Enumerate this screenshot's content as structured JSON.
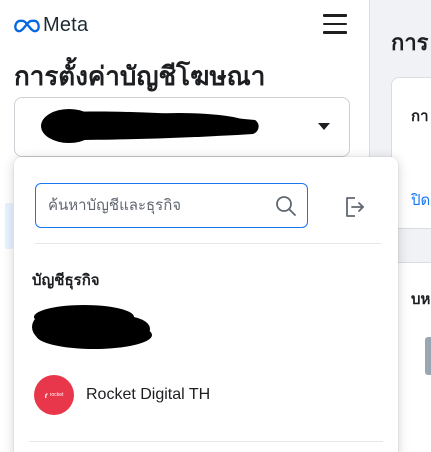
{
  "header": {
    "brand": "Meta",
    "brand_color": "#0668E1",
    "menu_icon": "hamburger-menu-icon"
  },
  "page": {
    "title": "การตั้งค่าบัญชีโฆษณา"
  },
  "account_selector": {
    "selected_value": "[redacted]",
    "caret_icon": "caret-down-icon"
  },
  "dropdown": {
    "search": {
      "placeholder": "ค้นหาบัญชีและธุรกิจ",
      "value": "",
      "icon": "search-icon"
    },
    "logout_icon": "logout-icon",
    "section_header": "บัญชีธุรกิจ",
    "items": [
      {
        "name": "[redacted]"
      },
      {
        "name": "Rocket Digital TH",
        "logo_text": "rocket",
        "logo_color": "#E8364A"
      }
    ]
  },
  "right_panel": {
    "title": "การ",
    "card1_title": "กา",
    "card1_link": "ปิด",
    "card2_title": "บห"
  },
  "colors": {
    "accent": "#1877F2",
    "text": "#1C1E21",
    "border": "#CCD0D5"
  }
}
